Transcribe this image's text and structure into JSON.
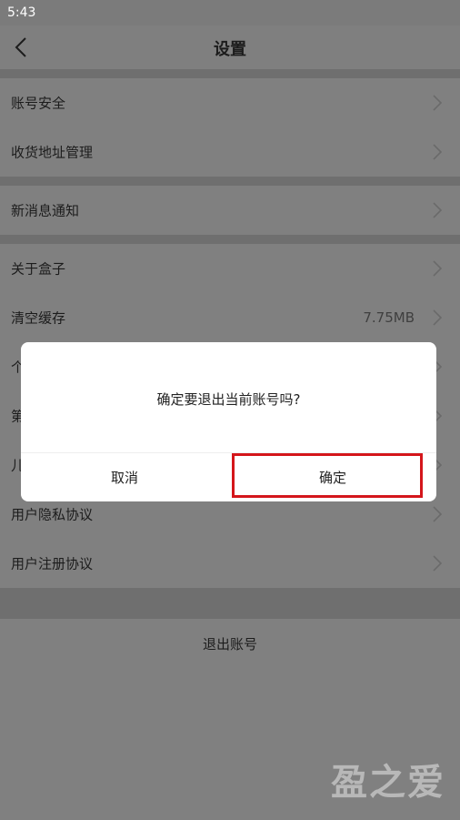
{
  "status": {
    "time": "5:43"
  },
  "header": {
    "title": "设置",
    "back_icon": "back-arrow-icon"
  },
  "groups": [
    {
      "items": [
        {
          "label": "账号安全"
        },
        {
          "label": "收货地址管理"
        }
      ]
    },
    {
      "items": [
        {
          "label": "新消息通知"
        }
      ]
    },
    {
      "items": [
        {
          "label": "关于盒子"
        },
        {
          "label": "清空缓存",
          "value": "7.75MB"
        },
        {
          "label": "个"
        },
        {
          "label": "第"
        },
        {
          "label": "儿"
        },
        {
          "label": "用户隐私协议"
        },
        {
          "label": "用户注册协议"
        }
      ]
    }
  ],
  "logout": {
    "label": "退出账号"
  },
  "dialog": {
    "message": "确定要退出当前账号吗?",
    "cancel": "取消",
    "confirm": "确定"
  },
  "watermark": "盈之爱",
  "colors": {
    "highlight": "#d4161b",
    "overlay": "#808080"
  }
}
